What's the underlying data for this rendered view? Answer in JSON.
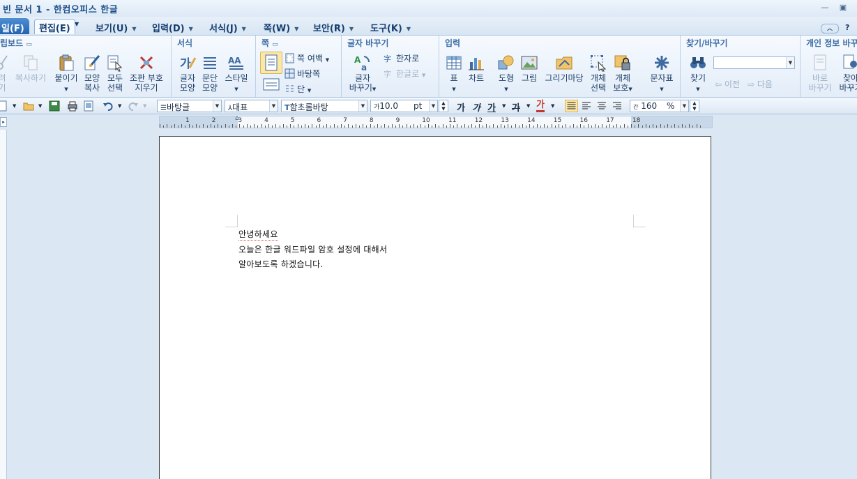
{
  "window": {
    "title": "빈 문서 1 - 한컴오피스 한글",
    "minimize_icon": "minimize-icon",
    "restore_icon": "restore-icon"
  },
  "menu": {
    "file": "일(F)",
    "tabs": [
      {
        "label": "편집(E)"
      },
      {
        "label": "보기(U)"
      },
      {
        "label": "입력(D)"
      },
      {
        "label": "서식(J)"
      },
      {
        "label": "쪽(W)"
      },
      {
        "label": "보안(R)"
      },
      {
        "label": "도구(K)"
      }
    ],
    "help": "?"
  },
  "ribbon": {
    "clipboard": {
      "title": "립보드",
      "cut_label": "려\n기",
      "copy_label": "복사하기",
      "paste_label": "붙이기",
      "format_copy_label": "모양\n복사",
      "select_all_label": "모두\n선택",
      "clear_format_label": "조판 부호\n지우기"
    },
    "format": {
      "title": "서식",
      "char_shape_label": "글자\n모양",
      "para_shape_label": "문단\n모양",
      "style_label": "스타일"
    },
    "page": {
      "title": "쪽",
      "margin_label": "쪽 여백",
      "background_label": "바탕쪽",
      "column_label": "단"
    },
    "char_change": {
      "title": "글자 바꾸기",
      "change_label": "글자\n바꾸기",
      "to_hanja_label": "한자로",
      "to_hangul_label": "한글로"
    },
    "input": {
      "title": "입력",
      "table_label": "표",
      "chart_label": "차트",
      "shape_label": "도형",
      "picture_label": "그림",
      "drawing_label": "그리기마당",
      "object_select_label": "개체\n선택",
      "object_protect_label": "개체\n보호",
      "symbol_label": "문자표"
    },
    "find": {
      "title": "찾기/바꾸기",
      "find_label": "찾기",
      "search_value": "",
      "prev_label": "이전",
      "next_label": "다음"
    },
    "privacy": {
      "title": "개인 정보 바꾸",
      "replace_label": "바로\n바꾸기",
      "find_replace_label": "찾아\n바꾸기"
    }
  },
  "format_toolbar": {
    "style": "바탕글",
    "language": "대표",
    "font": "함초롬바탕",
    "size_prefix": "가",
    "size": "10.0",
    "size_unit": "pt",
    "bold": "가",
    "italic": "가",
    "underline": "가",
    "strike": "가",
    "color_char": "가",
    "line_spacing_prefix": "간",
    "line_spacing": "160",
    "line_spacing_unit": "%"
  },
  "ruler": {
    "marks": [
      "1",
      "2",
      "3",
      "4",
      "5",
      "6",
      "7",
      "8",
      "9",
      "10",
      "11",
      "12",
      "13",
      "14",
      "15",
      "16",
      "17",
      "18"
    ]
  },
  "document": {
    "lines": [
      "안녕하세요",
      "오늘은 한글 워드파일 암호 설정에 대해서",
      "알아보도록 하겠습니다."
    ]
  },
  "colors": {
    "accent": "#2363ae",
    "ribbon_title": "#3c6da5",
    "background": "#dbe7f3"
  }
}
